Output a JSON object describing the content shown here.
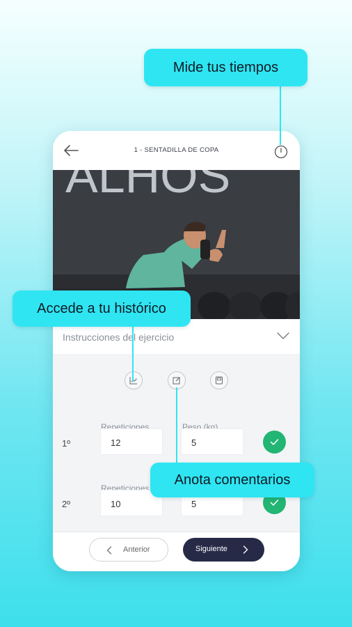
{
  "header": {
    "title": "1 - SENTADILLA DE COPA"
  },
  "video": {
    "wall_text": "ALHOS"
  },
  "instructions": {
    "label": "Instrucciones del ejercicio"
  },
  "sets": {
    "reps_label": "Repeticiones",
    "weight_label": "Peso (kg)",
    "rows": [
      {
        "label": "1º",
        "reps": "12",
        "weight": "5"
      },
      {
        "label": "2º",
        "reps": "10",
        "weight": "5"
      }
    ]
  },
  "nav": {
    "prev_label": "Anterior",
    "next_label": "Siguiente"
  },
  "callouts": {
    "timer": "Mide tus tiempos",
    "history": "Accede a tu histórico",
    "notes": "Anota comentarios"
  },
  "colors": {
    "callout": "#2fe5f2",
    "check": "#22b573",
    "primary_button": "#262a47"
  },
  "icons": [
    "back-arrow-icon",
    "timer-icon",
    "chevron-down-icon",
    "chart-icon",
    "edit-icon",
    "save-icon",
    "check-icon",
    "chevron-left-icon",
    "chevron-right-icon"
  ]
}
